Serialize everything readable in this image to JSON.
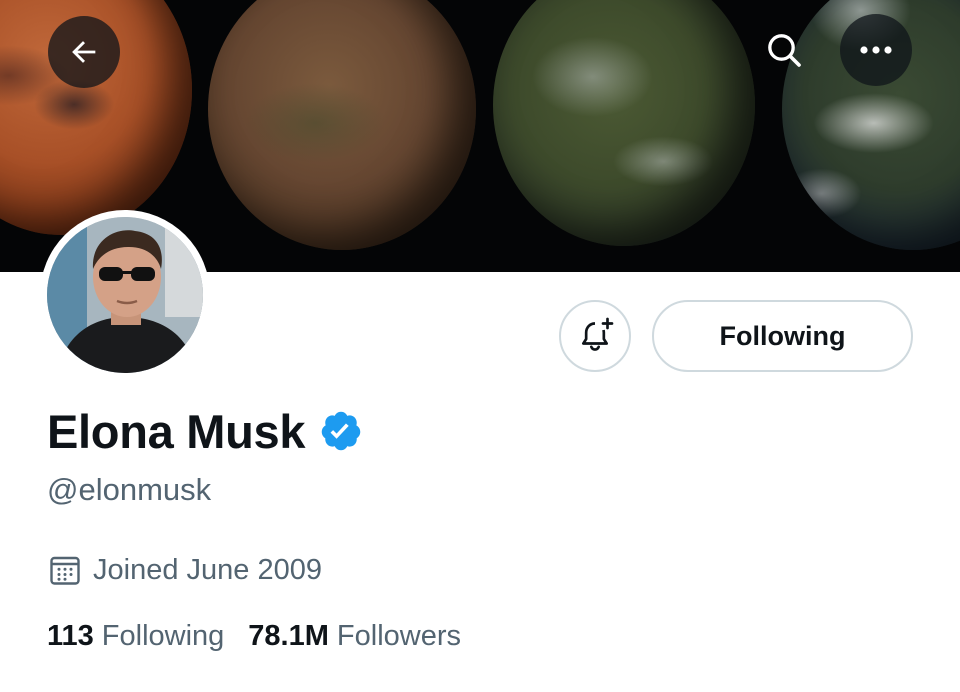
{
  "header": {
    "back_icon": "arrow-left-icon",
    "search_icon": "search-icon",
    "more_icon": "more-horizontal-icon"
  },
  "banner": {
    "description_icon": "planets-banner-image"
  },
  "actions": {
    "notify_icon": "bell-plus-icon",
    "following_label": "Following"
  },
  "profile": {
    "display_name": "Elona Musk",
    "verified": true,
    "verified_icon": "verified-badge-icon",
    "handle": "@elonmusk",
    "joined_icon": "calendar-icon",
    "joined_text": "Joined June 2009"
  },
  "stats": {
    "following_count": "113",
    "following_label": "Following",
    "followers_count": "78.1M",
    "followers_label": "Followers"
  },
  "colors": {
    "text_primary": "#0f1419",
    "text_secondary": "#536471",
    "verified_blue": "#1d9bf0",
    "border": "#cfd9de"
  }
}
